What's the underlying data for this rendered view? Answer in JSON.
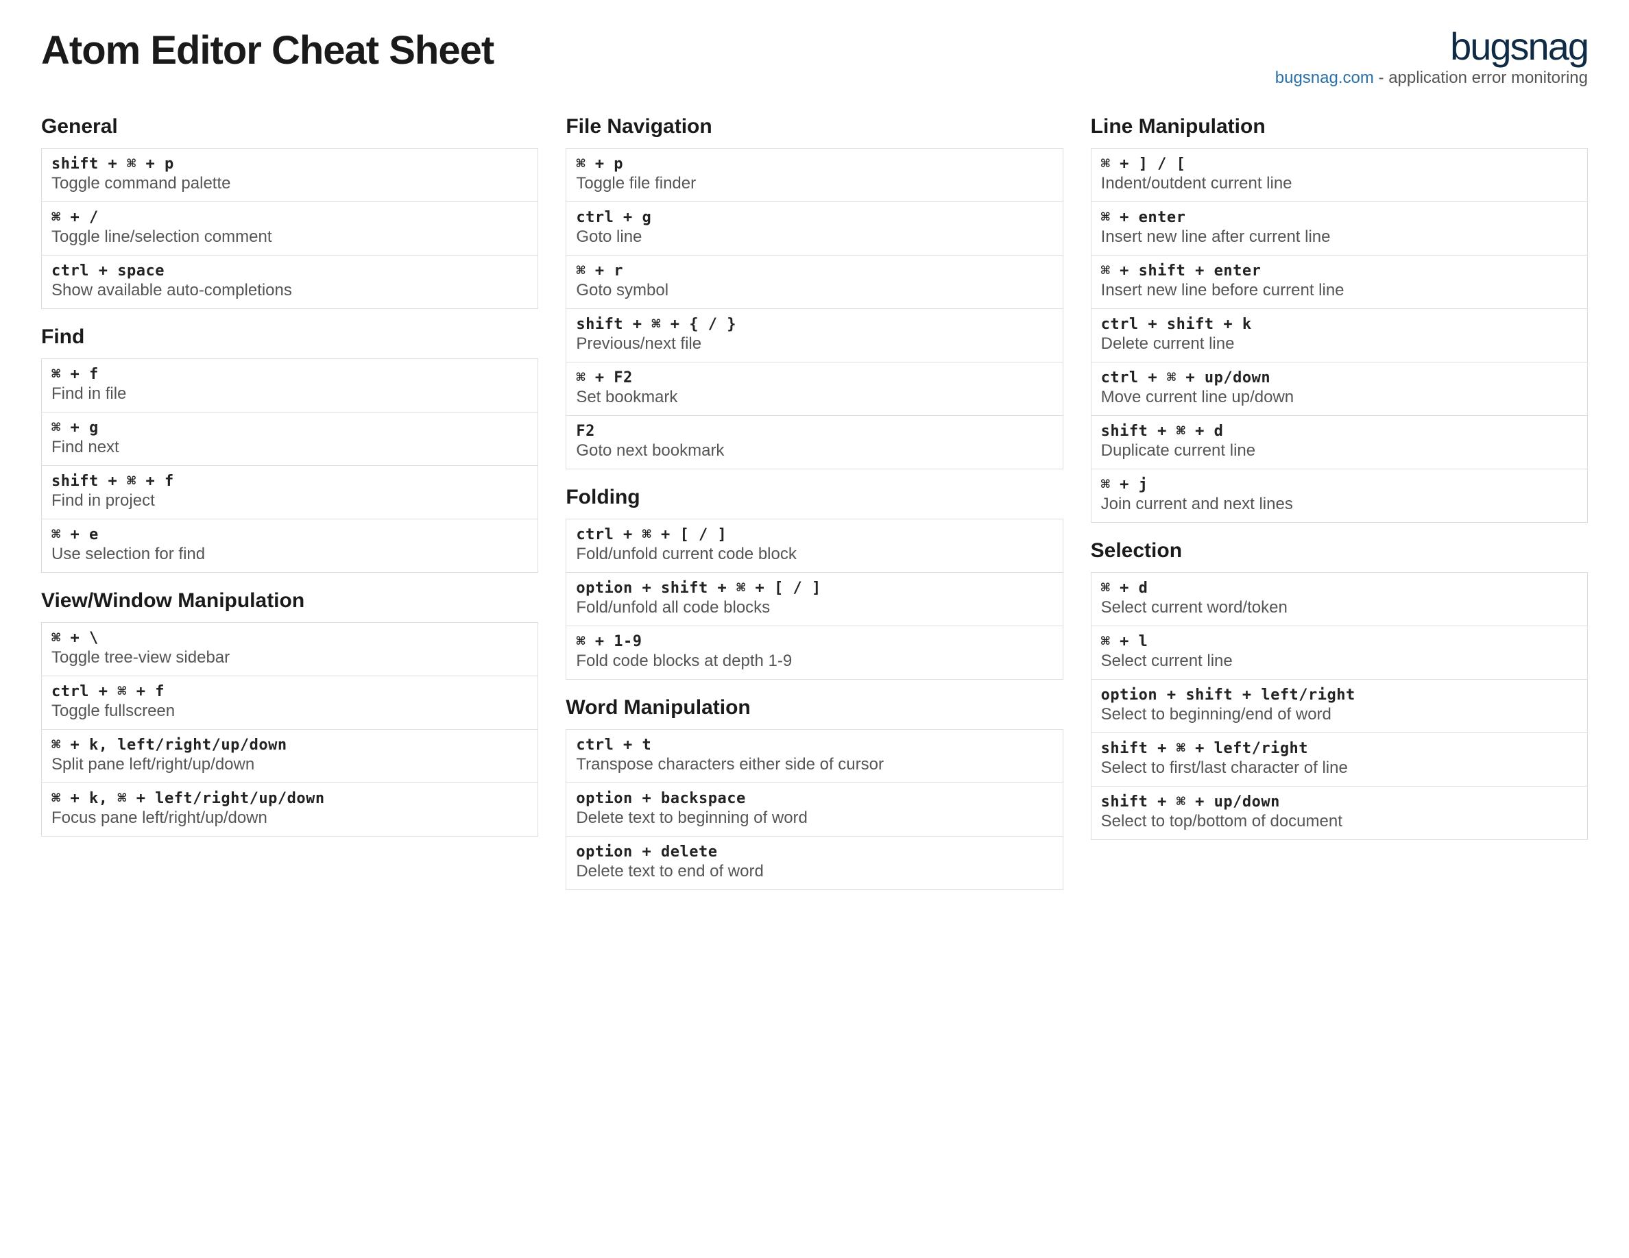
{
  "header": {
    "title": "Atom Editor Cheat Sheet",
    "brand_name": "bugsnag",
    "brand_link": "bugsnag.com",
    "brand_tagline": " - application error monitoring"
  },
  "columns": [
    {
      "sections": [
        {
          "title": "General",
          "rows": [
            {
              "keys": "shift + ⌘ + p",
              "desc": "Toggle command palette"
            },
            {
              "keys": "⌘ + /",
              "desc": "Toggle line/selection comment"
            },
            {
              "keys": "ctrl + space",
              "desc": "Show available auto-completions"
            }
          ]
        },
        {
          "title": "Find",
          "rows": [
            {
              "keys": "⌘ + f",
              "desc": "Find in file"
            },
            {
              "keys": "⌘ + g",
              "desc": "Find next"
            },
            {
              "keys": "shift + ⌘ + f",
              "desc": "Find in project"
            },
            {
              "keys": "⌘ + e",
              "desc": "Use selection for find"
            }
          ]
        },
        {
          "title": "View/Window Manipulation",
          "rows": [
            {
              "keys": "⌘ + \\",
              "desc": "Toggle tree-view sidebar"
            },
            {
              "keys": "ctrl + ⌘ + f",
              "desc": "Toggle fullscreen"
            },
            {
              "keys": "⌘ + k, left/right/up/down",
              "desc": "Split pane left/right/up/down"
            },
            {
              "keys": "⌘ + k, ⌘ + left/right/up/down",
              "desc": "Focus pane left/right/up/down"
            }
          ]
        }
      ]
    },
    {
      "sections": [
        {
          "title": "File Navigation",
          "rows": [
            {
              "keys": "⌘ + p",
              "desc": "Toggle file finder"
            },
            {
              "keys": "ctrl + g",
              "desc": "Goto line"
            },
            {
              "keys": "⌘ + r",
              "desc": "Goto symbol"
            },
            {
              "keys": "shift + ⌘ + { / }",
              "desc": "Previous/next file"
            },
            {
              "keys": "⌘ + F2",
              "desc": "Set bookmark"
            },
            {
              "keys": "F2",
              "desc": "Goto next bookmark"
            }
          ]
        },
        {
          "title": "Folding",
          "rows": [
            {
              "keys": "ctrl + ⌘ + [ / ]",
              "desc": "Fold/unfold current code block"
            },
            {
              "keys": "option + shift + ⌘ + [ / ]",
              "desc": "Fold/unfold all code blocks"
            },
            {
              "keys": "⌘ + 1-9",
              "desc": "Fold code blocks at depth 1-9"
            }
          ]
        },
        {
          "title": "Word Manipulation",
          "rows": [
            {
              "keys": "ctrl + t",
              "desc": "Transpose characters either side of cursor"
            },
            {
              "keys": "option + backspace",
              "desc": "Delete text to beginning of word"
            },
            {
              "keys": "option + delete",
              "desc": "Delete text to end of word"
            }
          ]
        }
      ]
    },
    {
      "sections": [
        {
          "title": "Line Manipulation",
          "rows": [
            {
              "keys": "⌘ + ] / [",
              "desc": "Indent/outdent current line"
            },
            {
              "keys": "⌘ + enter",
              "desc": "Insert new line after current line"
            },
            {
              "keys": "⌘ + shift + enter",
              "desc": "Insert new line before current line"
            },
            {
              "keys": "ctrl + shift + k",
              "desc": "Delete current line"
            },
            {
              "keys": "ctrl + ⌘ + up/down",
              "desc": "Move current line up/down"
            },
            {
              "keys": "shift + ⌘ + d",
              "desc": "Duplicate current line"
            },
            {
              "keys": "⌘ + j",
              "desc": "Join current and next lines"
            }
          ]
        },
        {
          "title": "Selection",
          "rows": [
            {
              "keys": "⌘ + d",
              "desc": "Select current word/token"
            },
            {
              "keys": "⌘ + l",
              "desc": "Select current line"
            },
            {
              "keys": "option + shift + left/right",
              "desc": "Select to beginning/end of word"
            },
            {
              "keys": "shift + ⌘ + left/right",
              "desc": "Select to first/last character of line"
            },
            {
              "keys": "shift + ⌘ + up/down",
              "desc": "Select to top/bottom of document"
            }
          ]
        }
      ]
    }
  ]
}
